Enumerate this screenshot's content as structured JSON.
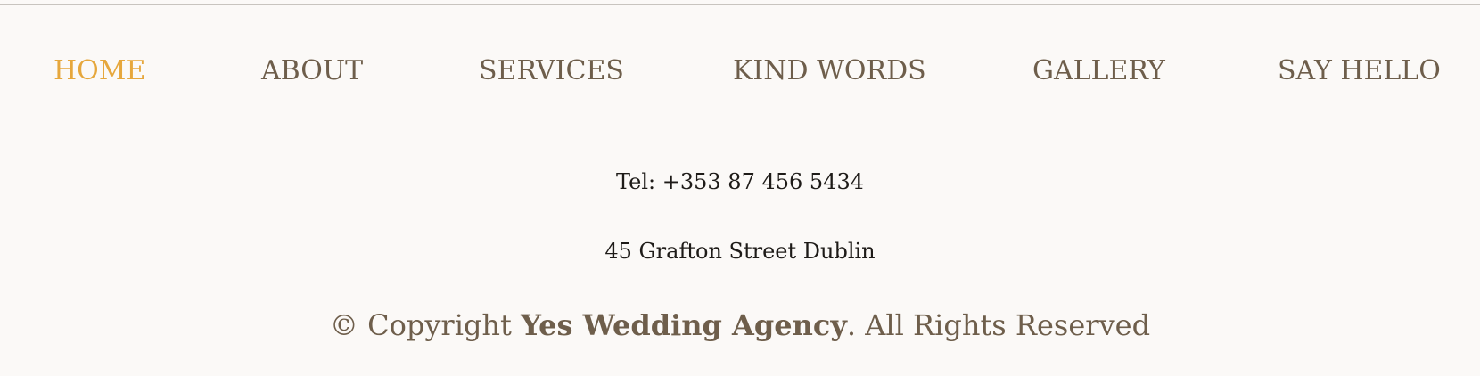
{
  "nav": {
    "items": [
      {
        "label": "HOME",
        "active": true
      },
      {
        "label": "ABOUT",
        "active": false
      },
      {
        "label": "SERVICES",
        "active": false
      },
      {
        "label": "KIND WORDS",
        "active": false
      },
      {
        "label": "GALLERY",
        "active": false
      },
      {
        "label": "SAY HELLO",
        "active": false
      }
    ]
  },
  "contact": {
    "tel": "Tel: +353 87 456 5434",
    "address": "45 Grafton Street Dublin"
  },
  "footer": {
    "copyright_prefix": "© Copyright ",
    "agency_name": "Yes Wedding Agency",
    "copyright_suffix": ". All Rights Reserved"
  },
  "colors": {
    "background": "#fbf9f7",
    "nav_text": "#6e5e4b",
    "nav_active": "#e6a73c",
    "body_text": "#1e1b18"
  }
}
